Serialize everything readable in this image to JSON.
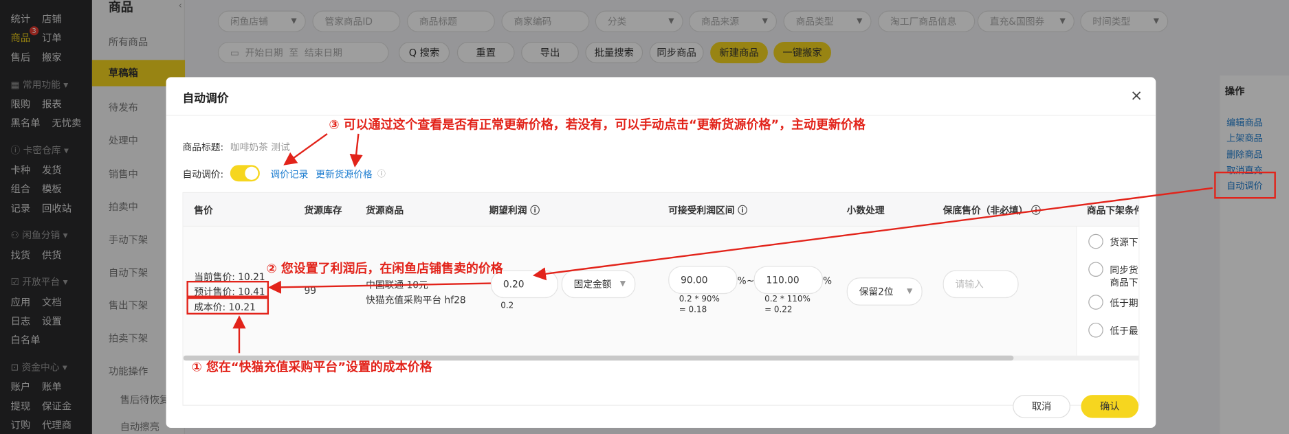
{
  "nav": {
    "rows": [
      [
        "统计",
        "店铺"
      ],
      [
        "商品",
        "订单"
      ],
      [
        "售后",
        "搬家"
      ]
    ],
    "badge": "3",
    "sections": [
      {
        "title": "常用功能",
        "rows": [
          [
            "限购",
            "报表"
          ],
          [
            "黑名单",
            "无忧卖"
          ]
        ]
      },
      {
        "title": "卡密仓库",
        "rows": [
          [
            "卡种",
            "发货"
          ],
          [
            "组合",
            "模板"
          ],
          [
            "记录",
            "回收站"
          ]
        ]
      },
      {
        "title": "闲鱼分销",
        "rows": [
          [
            "找货",
            "供货"
          ]
        ]
      },
      {
        "title": "开放平台",
        "rows": [
          [
            "应用",
            "文档"
          ],
          [
            "日志",
            "设置"
          ],
          [
            "白名单",
            ""
          ]
        ]
      },
      {
        "title": "资金中心",
        "rows": [
          [
            "账户",
            "账单"
          ],
          [
            "提现",
            "保证金"
          ],
          [
            "订购",
            "代理商"
          ]
        ]
      }
    ]
  },
  "subnav": {
    "head": "商品",
    "items": [
      "所有商品",
      "草稿箱",
      "待发布",
      "处理中",
      "销售中",
      "拍卖中",
      "手动下架",
      "自动下架",
      "售出下架",
      "拍卖下架",
      "功能操作",
      "售后待恢复",
      "自动擦亮"
    ],
    "active": "草稿箱"
  },
  "filters": {
    "row1": [
      "闲鱼店铺",
      "管家商品ID",
      "商品标题",
      "商家编码",
      "分类",
      "商品来源",
      "商品类型",
      "淘工厂商品信息",
      "直充&国图券",
      "时间类型"
    ],
    "date_start": "开始日期",
    "date_sep": "至",
    "date_end": "结束日期",
    "buttons": [
      "Q 搜索",
      "重置",
      "导出",
      "批量搜索",
      "同步商品",
      "新建商品",
      "一键搬家"
    ]
  },
  "opcol": {
    "header": "操作",
    "actions": [
      "编辑商品",
      "上架商品",
      "删除商品",
      "取消直充",
      "自动调价"
    ]
  },
  "modal": {
    "title": "自动调价",
    "product_title_label": "商品标题:",
    "product_title_value": "咖啡奶茶 测试",
    "auto_label": "自动调价:",
    "link_history": "调价记录",
    "link_update": "更新货源价格",
    "columns": [
      "售价",
      "货源库存",
      "货源商品",
      "期望利润",
      "可接受利润区间",
      "小数处理",
      "保底售价（非必填）",
      "商品下架条件"
    ],
    "row": {
      "current_price": "当前售价: 10.21",
      "estimated_price": "预计售价: 10.41",
      "cost_price": "成本价: 10.21",
      "stock": "99",
      "source_name": "中国联通 10元",
      "source_platform": "快猫充值采购平台  hf28",
      "profit_value": "0.20",
      "profit_note": "0.2",
      "profit_mode": "固定金额",
      "range_min": "90.00",
      "range_min_unit": "%~",
      "range_min_note1": "0.2 * 90%",
      "range_min_note2": "= 0.18",
      "range_max": "110.00",
      "range_max_unit": "%",
      "range_max_note1": "0.2 * 110%",
      "range_max_note2": "= 0.22",
      "decimal": "保留2位",
      "floor_placeholder": "请输入",
      "conditions": [
        "货源下",
        "同步货",
        "商品下",
        "低于期",
        "低于最"
      ]
    },
    "cancel": "取消",
    "confirm": "确认"
  },
  "annotations": {
    "a1": "① 您在“快猫充值采购平台”设置的成本价格",
    "a2": "② 您设置了利润后，在闲鱼店铺售卖的价格",
    "a3": "③ 可以通过这个查看是否有正常更新价格，若没有，可以手动点击“更新货源价格”，主动更新价格"
  },
  "colors": {
    "accent": "#f6d61f",
    "link": "#1f7ed0",
    "annotation": "#e2231a"
  }
}
